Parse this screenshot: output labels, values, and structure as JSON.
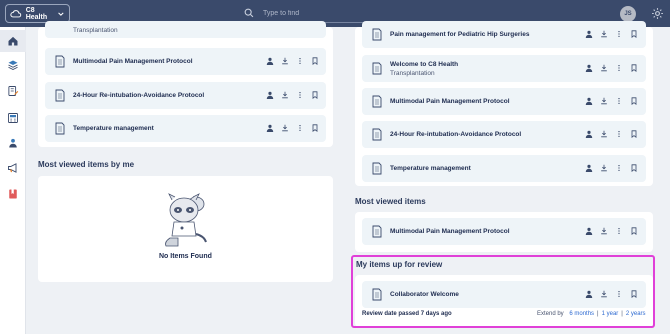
{
  "header": {
    "brand": "C8 Health",
    "search_placeholder": "Type to find",
    "avatar_initials": "JS"
  },
  "sidebar": {
    "items": [
      {
        "icon": "home-icon",
        "active": true
      },
      {
        "icon": "layers-icon",
        "active": false
      },
      {
        "icon": "edit-note-icon",
        "active": false
      },
      {
        "icon": "calculator-icon",
        "active": false
      },
      {
        "icon": "people-icon",
        "active": false
      },
      {
        "icon": "megaphone-icon",
        "active": false
      },
      {
        "icon": "bookmark-book-icon",
        "active": false
      }
    ]
  },
  "left": {
    "top_list": [
      {
        "title": "",
        "subtitle": "Transplantation"
      },
      {
        "title": "Multimodal Pain Management Protocol",
        "subtitle": ""
      },
      {
        "title": "24-Hour Re-intubation-Avoidance Protocol",
        "subtitle": ""
      },
      {
        "title": "Temperature management",
        "subtitle": ""
      }
    ],
    "most_viewed_by_me_title": "Most viewed items by me",
    "empty_text": "No Items Found"
  },
  "right": {
    "top_list": [
      {
        "title": "Pain management for Pediatric Hip Surgeries",
        "subtitle": ""
      },
      {
        "title": "Welcome to C8 Health",
        "subtitle": "Transplantation"
      },
      {
        "title": "Multimodal Pain Management Protocol",
        "subtitle": ""
      },
      {
        "title": "24-Hour Re-intubation-Avoidance Protocol",
        "subtitle": ""
      },
      {
        "title": "Temperature management",
        "subtitle": ""
      }
    ],
    "most_viewed_title": "Most viewed items",
    "most_viewed": [
      {
        "title": "Multimodal Pain Management Protocol"
      }
    ],
    "review_title": "My items up for review",
    "review_item": {
      "title": "Collaborator Welcome"
    },
    "review_date_text": "Review date passed 7 days ago",
    "extend_label": "Extend by",
    "extend_options": [
      "6 months",
      "1 year",
      "2 years"
    ],
    "extend_separator": "|"
  },
  "colors": {
    "topbar": "#3a4a6b",
    "accent_link": "#2f6bd1",
    "highlight": "#e040d8",
    "item_bg": "#eef4f8"
  }
}
